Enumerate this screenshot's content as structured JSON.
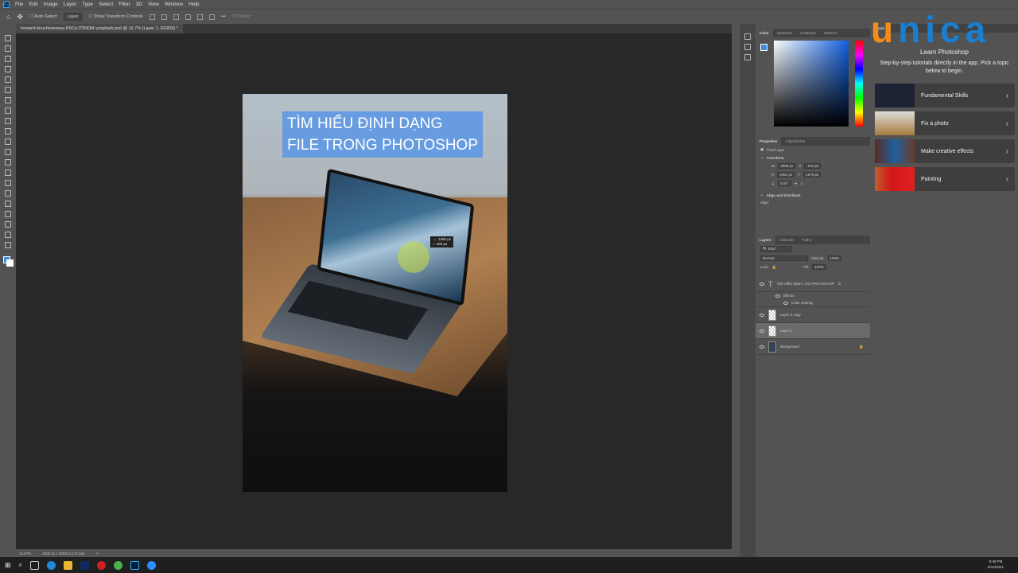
{
  "menu": [
    "File",
    "Edit",
    "Image",
    "Layer",
    "Type",
    "Select",
    "Filter",
    "3D",
    "View",
    "Window",
    "Help"
  ],
  "options": {
    "auto_select": "Auto-Select",
    "layer_select": "Layer",
    "show_transform": "Show Transform Controls",
    "more": "•••",
    "mode_3d": "3D Mode:"
  },
  "document_tab": "howard-bouchevereau-RSCirJ70NDM-unsplash.psd @ 16.7% (Layer 1, RGB/8) *",
  "canvas": {
    "title_line1": "TÌM HIỂU ĐỊNH DẠNG",
    "title_line2": "FILE TRONG PHOTOSHOP",
    "measure_x": "↔:  1290 px",
    "measure_y": "↕:  356 px"
  },
  "status": {
    "zoom": "16.67%",
    "doc_size": "4000 px x 6000 px (72 ppi)",
    "arrow": ">"
  },
  "color_panel": {
    "tabs": [
      "Color",
      "Swatches",
      "Gradients",
      "Patterns"
    ],
    "foreground": "#3a8ee6"
  },
  "properties": {
    "tabs": [
      "Properties",
      "Adjustments"
    ],
    "type": "Pixel Layer",
    "transform": "Transform",
    "w_label": "W",
    "w": "3088 px",
    "h_label": "H",
    "h": "2651 px",
    "x_label": "X",
    "x": "-933 px",
    "y_label": "Y",
    "y": "1675 px",
    "angle": "0.00°",
    "align": "Align and Distribute",
    "align_label": "Align:"
  },
  "layers": {
    "tabs": [
      "Layers",
      "Channels",
      "Paths"
    ],
    "filter": "Kind",
    "blend": "Normal",
    "opacity_label": "Opacity:",
    "opacity": "100%",
    "lock_label": "Lock:",
    "fill_label": "Fill:",
    "fill": "100%",
    "items": [
      {
        "name": "TÌM HIỂU ĐỊNH...NG PHOTOSHOP",
        "fx": "fx"
      },
      {
        "name": "Effects"
      },
      {
        "name": "Color Overlay"
      },
      {
        "name": "Layer 3 copy"
      },
      {
        "name": "Layer 1"
      },
      {
        "name": "Background"
      }
    ]
  },
  "learn": {
    "tab": "Learn",
    "title": "Learn Photoshop",
    "subtitle": "Step-by-step tutorials directly in the app. Pick a topic below to begin.",
    "cards": [
      {
        "label": "Fundamental Skills"
      },
      {
        "label": "Fix a photo"
      },
      {
        "label": "Make creative effects"
      },
      {
        "label": "Painting"
      }
    ]
  },
  "logo": {
    "u": "u",
    "rest": "nica"
  },
  "taskbar": {
    "time": "9:48 PM",
    "date": "5/12/2021"
  }
}
